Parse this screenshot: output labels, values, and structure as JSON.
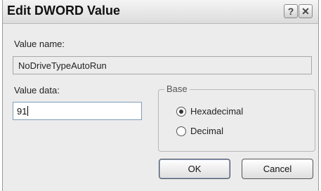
{
  "dialog": {
    "title": "Edit DWORD Value",
    "help_glyph": "?",
    "close_glyph": "✕"
  },
  "value_name": {
    "label": "Value name:",
    "value": "NoDriveTypeAutoRun"
  },
  "value_data": {
    "label": "Value data:",
    "value": "91"
  },
  "base": {
    "label": "Base",
    "options": [
      {
        "label": "Hexadecimal",
        "selected": true
      },
      {
        "label": "Decimal",
        "selected": false
      }
    ]
  },
  "buttons": {
    "ok": "OK",
    "cancel": "Cancel"
  }
}
